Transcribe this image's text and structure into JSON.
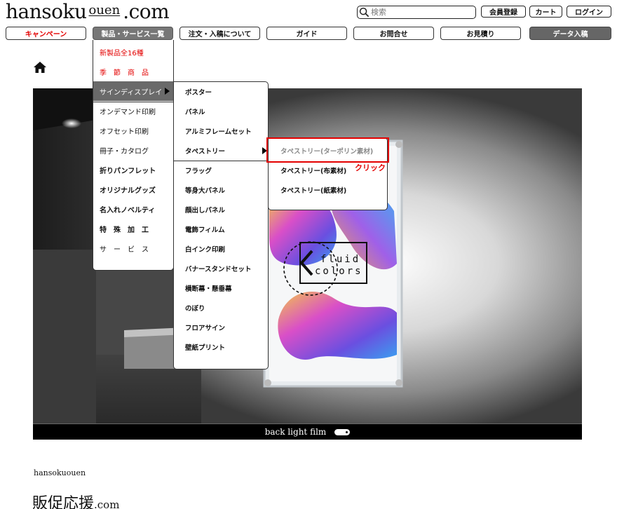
{
  "header": {
    "logo": {
      "main": "hansoku",
      "mid": "ouen",
      "tail": ".com"
    },
    "search_placeholder": "検索",
    "buttons": {
      "register": "会員登録",
      "cart": "カート",
      "login": "ログイン"
    }
  },
  "nav": {
    "campaign": "キャンペーン",
    "products": "製品・サービス一覧",
    "order": "注文・入稿について",
    "guide": "ガイド",
    "contact": "お問合せ",
    "estimate": "お見積り",
    "data_upload": "データ入稿"
  },
  "menu_level1": [
    "新製品全16種",
    "季　節　商　品",
    "サインディスプレイ",
    "オンデマンド印刷",
    "オフセット印刷",
    "冊子・カタログ",
    "折りパンフレット",
    "オリジナルグッズ",
    "名入れノベルティ",
    "特　殊　加　工",
    "サ　ー　ビ　ス"
  ],
  "menu_level2": [
    "ポスター",
    "パネル",
    "アルミフレームセット",
    "タペストリー",
    "フラッグ",
    "等身大パネル",
    "顔出しパネル",
    "電飾フィルム",
    "白インク印刷",
    "バナースタンドセット",
    "横断幕・懸垂幕",
    "のぼり",
    "フロアサイン",
    "壁紙プリント"
  ],
  "menu_level3": [
    "タペストリー(ターポリン素材)",
    "タペストリー(布素材)",
    "タペストリー(紙素材)"
  ],
  "annotation": {
    "click": "クリック"
  },
  "hero": {
    "poster_text": [
      "fluid",
      "colors"
    ],
    "caption": "back light film"
  },
  "footer": {
    "brand": "hansokuouen",
    "logo_kanji": "販促応援",
    "logo_com": ".com"
  },
  "colors": {
    "accent_red": "#e30000",
    "menu_highlight": "#6a6a6a"
  }
}
